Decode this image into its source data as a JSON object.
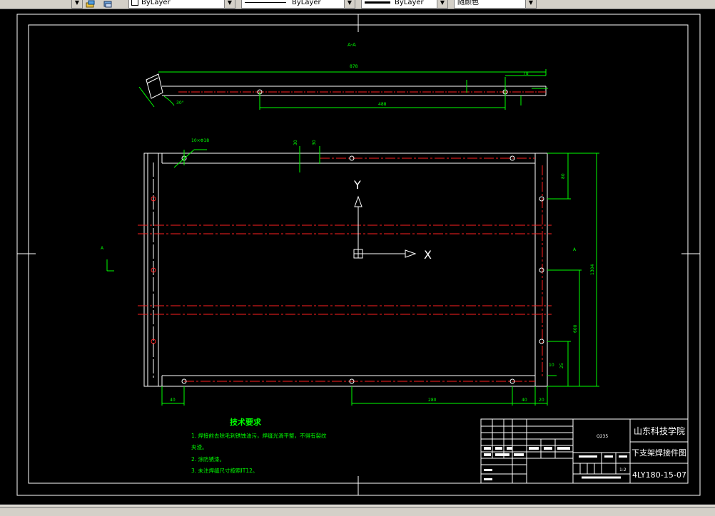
{
  "toolbar": {
    "layer_value": "ByLayer",
    "linetype_value": "ByLayer",
    "lineweight_value": "ByLayer",
    "color_value": "随颜色"
  },
  "drawing": {
    "section_label": "A-A",
    "view_label": "A",
    "dims": {
      "top_overall": "878",
      "top_right": "78",
      "top_bottom": "488",
      "angle": "30°",
      "hole_note": "10×Φ18",
      "plan_d1": "30",
      "plan_d2": "30",
      "right_top": "80",
      "right_overall": "1304",
      "right_mid": "600",
      "right_small1": "10",
      "right_small2": "25",
      "bottom_left": "40",
      "bottom_mid": "280",
      "bottom_right1": "40",
      "bottom_right2": "20"
    },
    "ucs": {
      "x_label": "X",
      "y_label": "Y"
    },
    "notes_title": "技术要求",
    "notes": [
      "1. 焊接前去除毛刺锈蚀油污，焊缝光滑平整，不得有裂纹",
      "夹渣。",
      "2. 涂防锈漆。",
      "3. 未注焊缝尺寸按照IT12。"
    ],
    "title_block": {
      "material": "Q235",
      "scale": "1:2",
      "company": "山东科技学院",
      "part_name": "下支架焊接件图",
      "drawing_number": "4LY180-15-07"
    }
  }
}
